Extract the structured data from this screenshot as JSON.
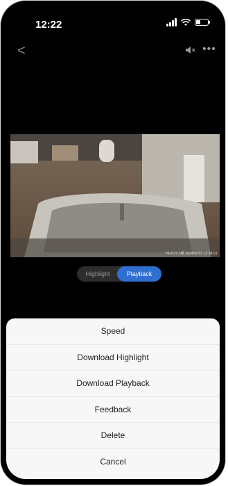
{
  "status_bar": {
    "time": "12:22"
  },
  "nav": {
    "back": "<",
    "more": "•••"
  },
  "video": {
    "watermark": "PETOT小佩 2024/01/31 12:24:13"
  },
  "toggle": {
    "highlight_label": "Highlight",
    "playback_label": "Playback",
    "selected": "Playback"
  },
  "sheet": {
    "items": [
      {
        "label": "Speed"
      },
      {
        "label": "Download Highlight"
      },
      {
        "label": "Download Playback"
      },
      {
        "label": "Feedback"
      },
      {
        "label": "Delete"
      },
      {
        "label": "Cancel"
      }
    ]
  },
  "colors": {
    "accent": "#2f6fd0",
    "sheet_bg": "#f7f7f7",
    "screen_bg": "#000000"
  }
}
